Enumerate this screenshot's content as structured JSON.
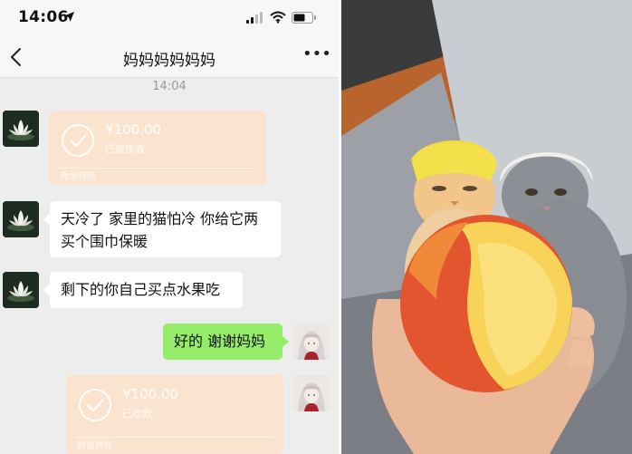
{
  "status_bar": {
    "time": "14:06"
  },
  "chat": {
    "title": "妈妈妈妈妈妈",
    "timestamp": "14:04",
    "messages": [
      {
        "type": "transfer",
        "from": "contact",
        "amount": "¥100.00",
        "status": "已被接收",
        "footer": "微信转账"
      },
      {
        "type": "text",
        "from": "contact",
        "text_line1": "天冷了 家里的猫怕冷 你给它两",
        "text_line2": "买个围巾保暖"
      },
      {
        "type": "text",
        "from": "contact",
        "text": "剩下的你自己买点水果吃"
      },
      {
        "type": "text",
        "from": "me",
        "text": "好的 谢谢妈妈"
      },
      {
        "type": "transfer",
        "from": "me",
        "amount": "¥100.00",
        "status": "已收款",
        "footer": "微信转账"
      }
    ]
  },
  "icons": {
    "location": "location-arrow-icon",
    "signal": "signal-bars-icon",
    "wifi": "wifi-icon",
    "battery": "battery-icon",
    "back": "chevron-left-icon",
    "more": "more-dots-icon",
    "received": "check-circle-icon"
  },
  "colors": {
    "chat_background": "#ededed",
    "outgoing_bubble": "#95ec69",
    "incoming_bubble": "#ffffff",
    "transfer_card": "#fbe4cf"
  }
}
